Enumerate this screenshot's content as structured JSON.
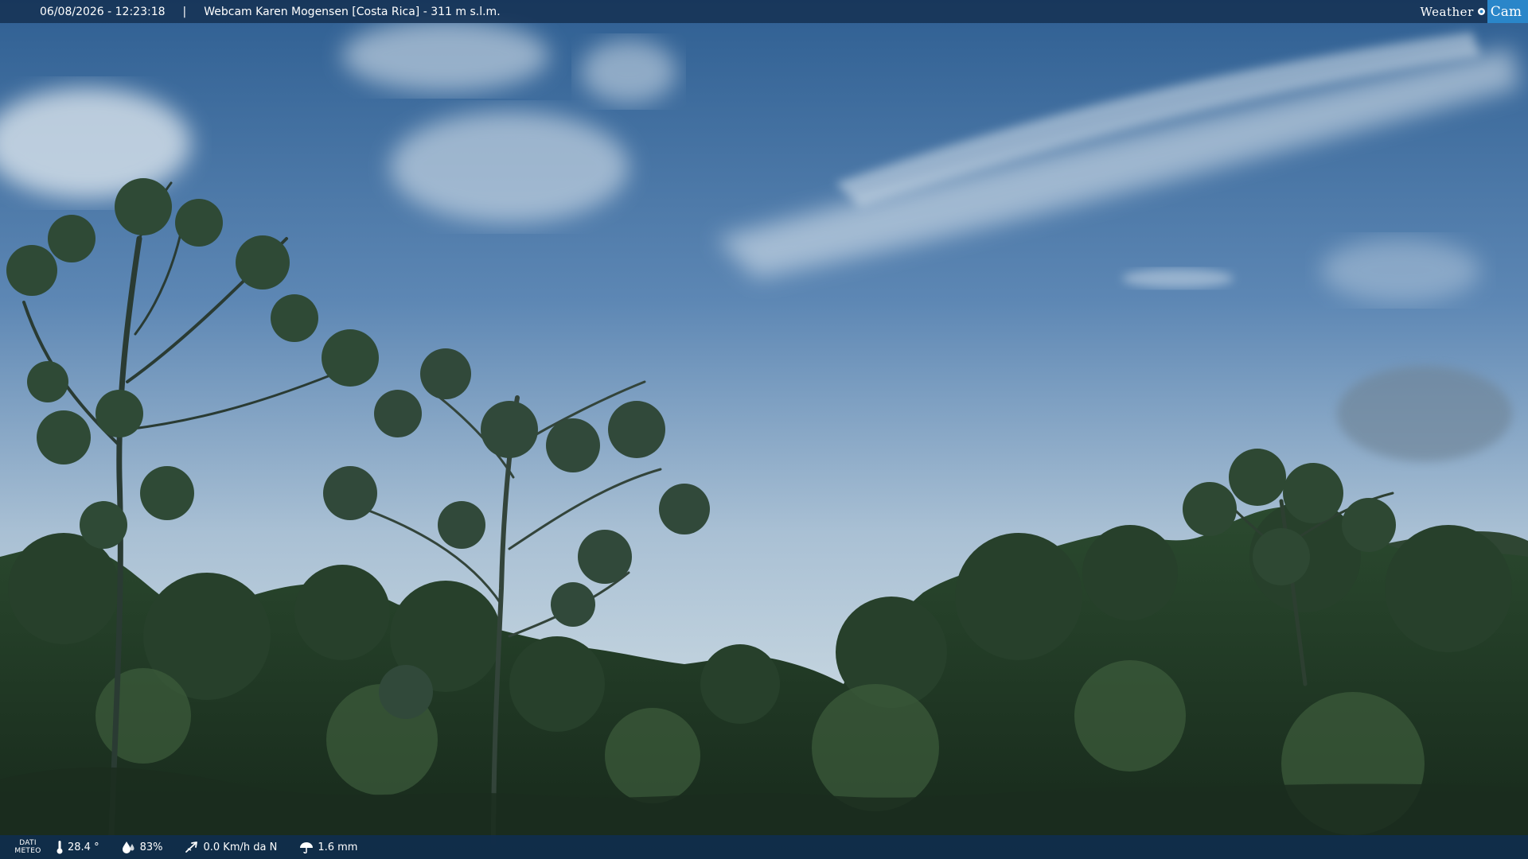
{
  "header": {
    "timestamp": "06/08/2026 - 12:23:18",
    "separator": "|",
    "title": "Webcam Karen Mogensen [Costa Rica]  - 311 m s.l.m."
  },
  "logo": {
    "weather": "Weather",
    "cam": "Cam"
  },
  "footer": {
    "dati_label_line1": "DATI",
    "dati_label_line2": "METEO",
    "temperature": "28.4 °",
    "humidity": "83%",
    "wind": "0.0 Km/h da N",
    "rain": "1.6 mm"
  },
  "colors": {
    "bar_background": "#163254",
    "logo_accent": "#2a86c9",
    "sky_top": "#2f5f92",
    "sky_horizon": "#c2d3de",
    "forest": "#233a26"
  }
}
